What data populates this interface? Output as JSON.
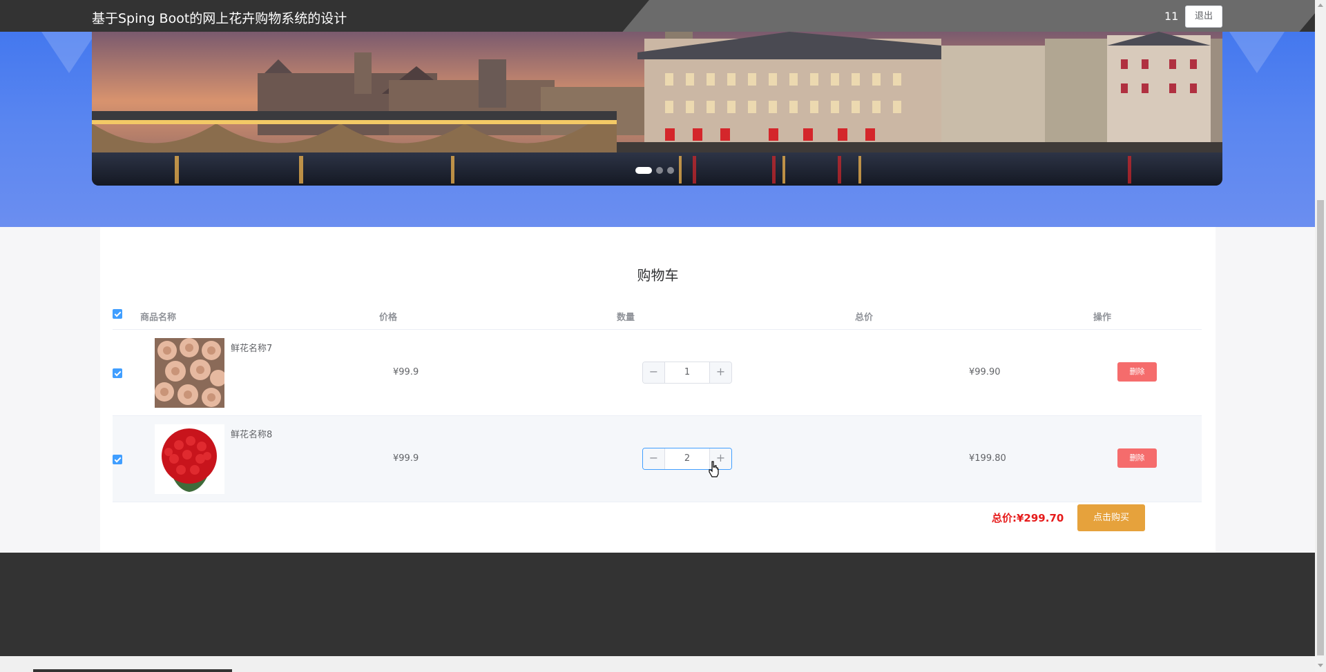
{
  "header": {
    "title": "基于Sping Boot的网上花卉购物系统的设计",
    "user": "11",
    "logout_label": "退出"
  },
  "carousel": {
    "slide_count": 3,
    "active_index": 0
  },
  "cart": {
    "title": "购物车",
    "columns": [
      "商品名称",
      "价格",
      "数量",
      "总价",
      "操作"
    ],
    "items": [
      {
        "name": "鲜花名称7",
        "price": "¥99.9",
        "quantity": "1",
        "total": "¥99.90",
        "delete_label": "删除",
        "checked": true,
        "image": "pink-roses-bouquet"
      },
      {
        "name": "鲜花名称8",
        "price": "¥99.9",
        "quantity": "2",
        "total": "¥199.80",
        "delete_label": "删除",
        "checked": true,
        "image": "red-roses-bouquet"
      }
    ],
    "summary_label": "总价:",
    "summary_value": "¥299.70",
    "buy_label": "点击购买"
  },
  "colors": {
    "topbar": "#333333",
    "banner_blue": "#5a86f0",
    "checkbox": "#409eff",
    "delete": "#f56c6c",
    "buy": "#e6a23c",
    "total_red": "#e61b1b"
  },
  "icons": [
    "minus-icon",
    "plus-icon",
    "check-icon",
    "pointer-cursor-icon"
  ]
}
